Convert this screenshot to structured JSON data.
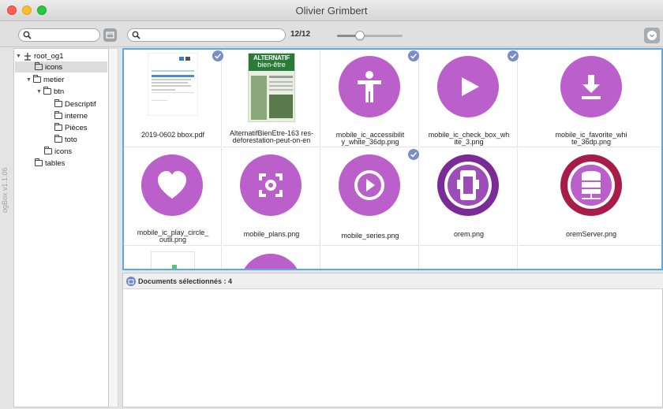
{
  "window": {
    "title": "Olivier Grimbert",
    "version": "ogBox v1.1.06"
  },
  "toolbar": {
    "count": "12/12",
    "zoom_level": 0.35
  },
  "tree": {
    "nodes": [
      {
        "label": "root_og1",
        "depth": 0,
        "expanded": true
      },
      {
        "label": "icons",
        "depth": 1,
        "selected": true
      },
      {
        "label": "metier",
        "depth": 1,
        "expanded": true
      },
      {
        "label": "btn",
        "depth": 2,
        "expanded": true
      },
      {
        "label": "Descriptif",
        "depth": 3
      },
      {
        "label": "interne",
        "depth": 3
      },
      {
        "label": "Pièces",
        "depth": 3
      },
      {
        "label": "toto",
        "depth": 3
      },
      {
        "label": "icons",
        "depth": 2
      },
      {
        "label": "tables",
        "depth": 1
      }
    ]
  },
  "grid": {
    "accent_color": "#bb5fca",
    "items": [
      {
        "caption": "2019-0602 bbox.pdf",
        "icon": "document-thumbnail",
        "selected": true
      },
      {
        "caption": "AlternatifBienEtre-163 res-deforestation-peut-on-en",
        "icon": "magazine-thumbnail",
        "selected": false
      },
      {
        "caption": "mobile_ic_accessibilit y_white_36dp.png",
        "icon": "accessibility-icon",
        "selected": true
      },
      {
        "caption": "mobile_ic_check_box_wh ite_3.png",
        "icon": "play-icon",
        "selected": true
      },
      {
        "caption": "mobile_ic_favorite_whi te_36dp.png",
        "icon": "download-icon",
        "selected": false
      },
      {
        "caption": "mobile_ic_play_circle_ outli.png",
        "icon": "heart-icon",
        "selected": false
      },
      {
        "caption": "mobile_plans.png",
        "icon": "focus-icon",
        "selected": false
      },
      {
        "caption": "mobile_series.png",
        "icon": "play-circle-icon",
        "selected": true
      },
      {
        "caption": "orem.png",
        "icon": "orem-logo-icon",
        "selected": false
      },
      {
        "caption": "oremServer.png",
        "icon": "database-server-icon",
        "selected": false
      }
    ],
    "magazine_header": [
      "ALTERNATIF",
      "bien-être"
    ]
  },
  "bottom": {
    "label": "Documents sélectionnés : 4"
  }
}
